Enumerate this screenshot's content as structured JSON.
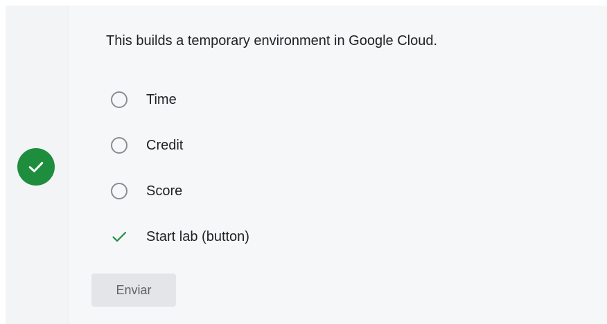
{
  "question": {
    "text": "This builds a temporary environment in Google Cloud."
  },
  "options": [
    {
      "label": "Time",
      "state": "unselected"
    },
    {
      "label": "Credit",
      "state": "unselected"
    },
    {
      "label": "Score",
      "state": "unselected"
    },
    {
      "label": "Start lab (button)",
      "state": "correct"
    }
  ],
  "status": {
    "icon": "check-circle-icon",
    "result": "correct",
    "color": "#1e8e3e"
  },
  "submit": {
    "label": "Enviar"
  },
  "colors": {
    "correct": "#1e8e3e",
    "radio_border": "#8a8c90",
    "card_bg": "#f6f7f9"
  }
}
